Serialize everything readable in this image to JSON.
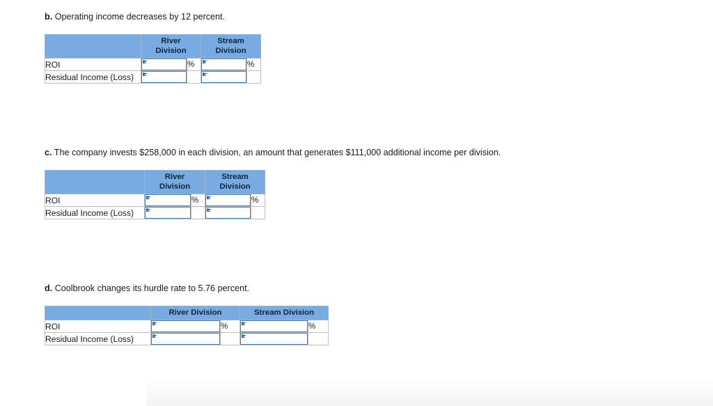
{
  "page": {
    "background": "#ffffff",
    "header_fill": "#79abe2",
    "input_border": "#4a7cb5",
    "table_border": "#939393"
  },
  "sections": [
    {
      "id": "b",
      "letter": "b.",
      "prompt": "Operating income decreases by 12 percent.",
      "table": {
        "header_style": "two-line",
        "columns": [
          "",
          "River Division",
          "Stream Division"
        ],
        "column_lines": [
          [
            "",
            ""
          ],
          [
            "River",
            "Division"
          ],
          [
            "Stream",
            "Division"
          ]
        ],
        "rows": [
          {
            "label": "ROI",
            "cells": [
              {
                "value": "",
                "suffix": "%"
              },
              {
                "value": "",
                "suffix": "%"
              }
            ]
          },
          {
            "label": "Residual Income (Loss)",
            "cells": [
              {
                "value": "",
                "suffix": ""
              },
              {
                "value": "",
                "suffix": ""
              }
            ]
          }
        ]
      }
    },
    {
      "id": "c",
      "letter": "c.",
      "prompt": "The company invests $258,000 in each division, an amount that generates $111,000 additional income per division.",
      "table": {
        "header_style": "two-line",
        "columns": [
          "",
          "River Division",
          "Stream Division"
        ],
        "column_lines": [
          [
            "",
            ""
          ],
          [
            "River",
            "Division"
          ],
          [
            "Stream",
            "Division"
          ]
        ],
        "rows": [
          {
            "label": "ROI",
            "cells": [
              {
                "value": "",
                "suffix": "%"
              },
              {
                "value": "",
                "suffix": "%"
              }
            ]
          },
          {
            "label": "Residual Income (Loss)",
            "cells": [
              {
                "value": "",
                "suffix": ""
              },
              {
                "value": "",
                "suffix": ""
              }
            ]
          }
        ]
      }
    },
    {
      "id": "d",
      "letter": "d.",
      "prompt": "Coolbrook changes its hurdle rate to 5.76 percent.",
      "table": {
        "header_style": "one-line",
        "columns": [
          "",
          "River Division",
          "Stream Division"
        ],
        "column_lines": [
          [
            ""
          ],
          [
            "River Division"
          ],
          [
            "Stream Division"
          ]
        ],
        "rows": [
          {
            "label": "ROI",
            "cells": [
              {
                "value": "",
                "suffix": "%"
              },
              {
                "value": "",
                "suffix": "%"
              }
            ]
          },
          {
            "label": "Residual Income (Loss)",
            "cells": [
              {
                "value": "",
                "suffix": ""
              },
              {
                "value": "",
                "suffix": ""
              }
            ]
          }
        ]
      }
    }
  ],
  "icons": {
    "corner_flag": "corner-flag-icon"
  }
}
